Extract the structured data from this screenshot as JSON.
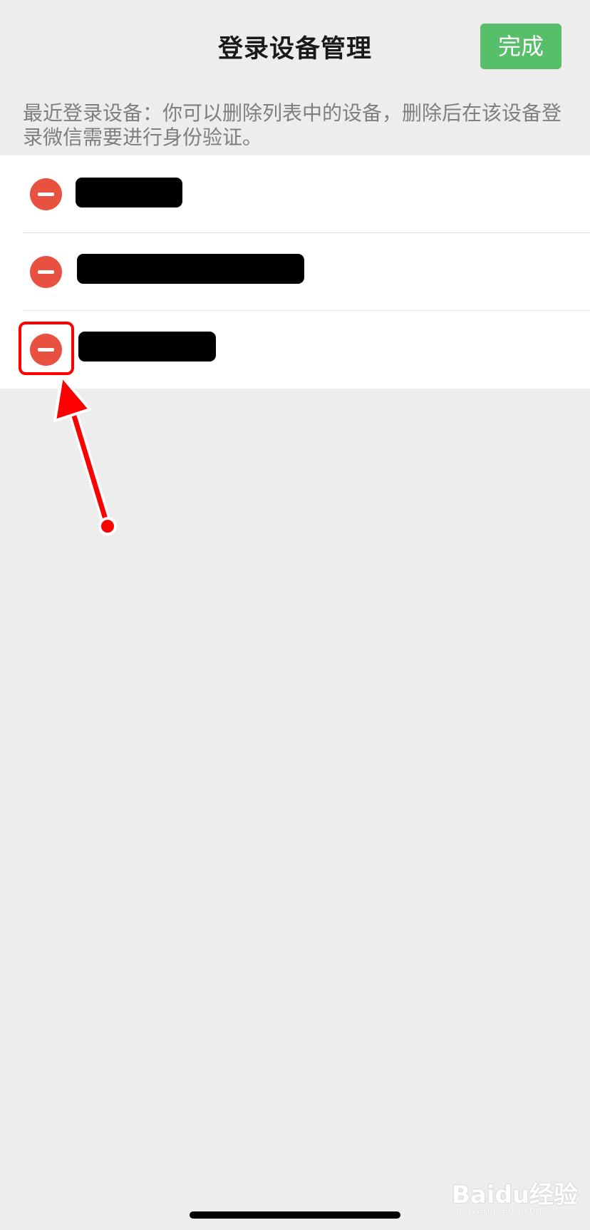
{
  "nav": {
    "title": "登录设备管理",
    "done_label": "完成"
  },
  "description": "最近登录设备：你可以删除列表中的设备，删除后在该设备登录微信需要进行身份验证。",
  "devices": [
    {
      "name_redacted": true
    },
    {
      "name_redacted": true
    },
    {
      "name_redacted": true
    }
  ],
  "icons": {
    "delete": "minus-circle-icon"
  },
  "colors": {
    "background": "#ededed",
    "done_button": "#57be6a",
    "delete_icon": "#e8503f",
    "annotation": "#ff0000"
  },
  "watermark": {
    "logo": "Baidu经验",
    "url": "jingyan.baidu.com"
  }
}
